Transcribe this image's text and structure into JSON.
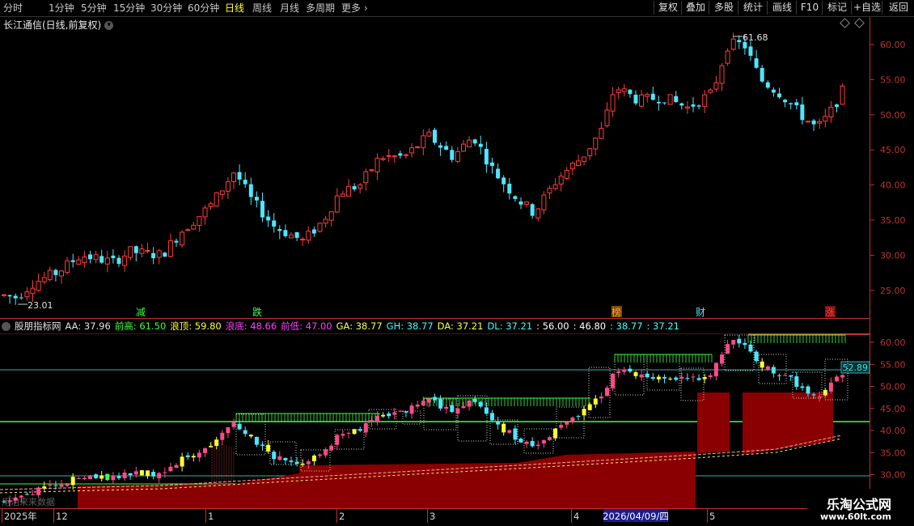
{
  "toolbar": {
    "periods": [
      "分时",
      "1分钟",
      "5分钟",
      "15分钟",
      "30分钟",
      "60分钟",
      "日线",
      "周线",
      "月线",
      "多周期",
      "更多"
    ],
    "active_period": "日线",
    "right_buttons": [
      "复权",
      "叠加",
      "多股",
      "统计",
      "画线",
      "F10",
      "标记",
      "+自选",
      "返回"
    ]
  },
  "main_title": "长江通信(日线,前复权)",
  "price_axis": [
    "60.00",
    "55.00",
    "50.00",
    "45.00",
    "40.00",
    "35.00",
    "30.00",
    "25.00"
  ],
  "annotations": {
    "high": "61.68",
    "low": "23.01"
  },
  "event_markers": [
    "减",
    "跌",
    "榜",
    "财",
    "涨"
  ],
  "indicator": {
    "name": "股朋指标网",
    "values": [
      {
        "label": "AA: 37.96",
        "color": "#e0e0e0"
      },
      {
        "label": "前高: 61.50",
        "color": "#40ff40"
      },
      {
        "label": "浪顶: 59.80",
        "color": "#ffff40"
      },
      {
        "label": "浪底: 48.66",
        "color": "#ff40ff"
      },
      {
        "label": "前低: 47.00",
        "color": "#ff40ff"
      },
      {
        "label": "GA: 38.77",
        "color": "#ffff40"
      },
      {
        "label": "GH: 38.77",
        "color": "#40ffff"
      },
      {
        "label": "DA: 37.21",
        "color": "#ffff40"
      },
      {
        "label": "DL: 37.21",
        "color": "#40ffff"
      },
      {
        "label": ": 56.00",
        "color": "#ffffff"
      },
      {
        "label": ": 46.80",
        "color": "#ffffff"
      },
      {
        "label": ": 38.77",
        "color": "#40ffff"
      },
      {
        "label": ": 37.21",
        "color": "#40ffff"
      }
    ],
    "axis": [
      "60.00",
      "55.00",
      "50.00",
      "45.00",
      "40.00",
      "35.00",
      "30.00"
    ],
    "current_value": "52.89",
    "ghost_text": "用泊来来数据"
  },
  "date_axis": {
    "labels": [
      "2025年",
      "12",
      "1",
      "2",
      "3",
      "4",
      "5"
    ],
    "cursor": "2026/04/09/四"
  },
  "watermark": {
    "line1": "乐淘公式网",
    "line2": "www.60lt.com"
  },
  "colors": {
    "up": "#ff3c3c",
    "down": "#4ee6ff",
    "axis": "#c03030",
    "green_line": "#40ff40",
    "cyan_line": "#40c8c8"
  }
}
